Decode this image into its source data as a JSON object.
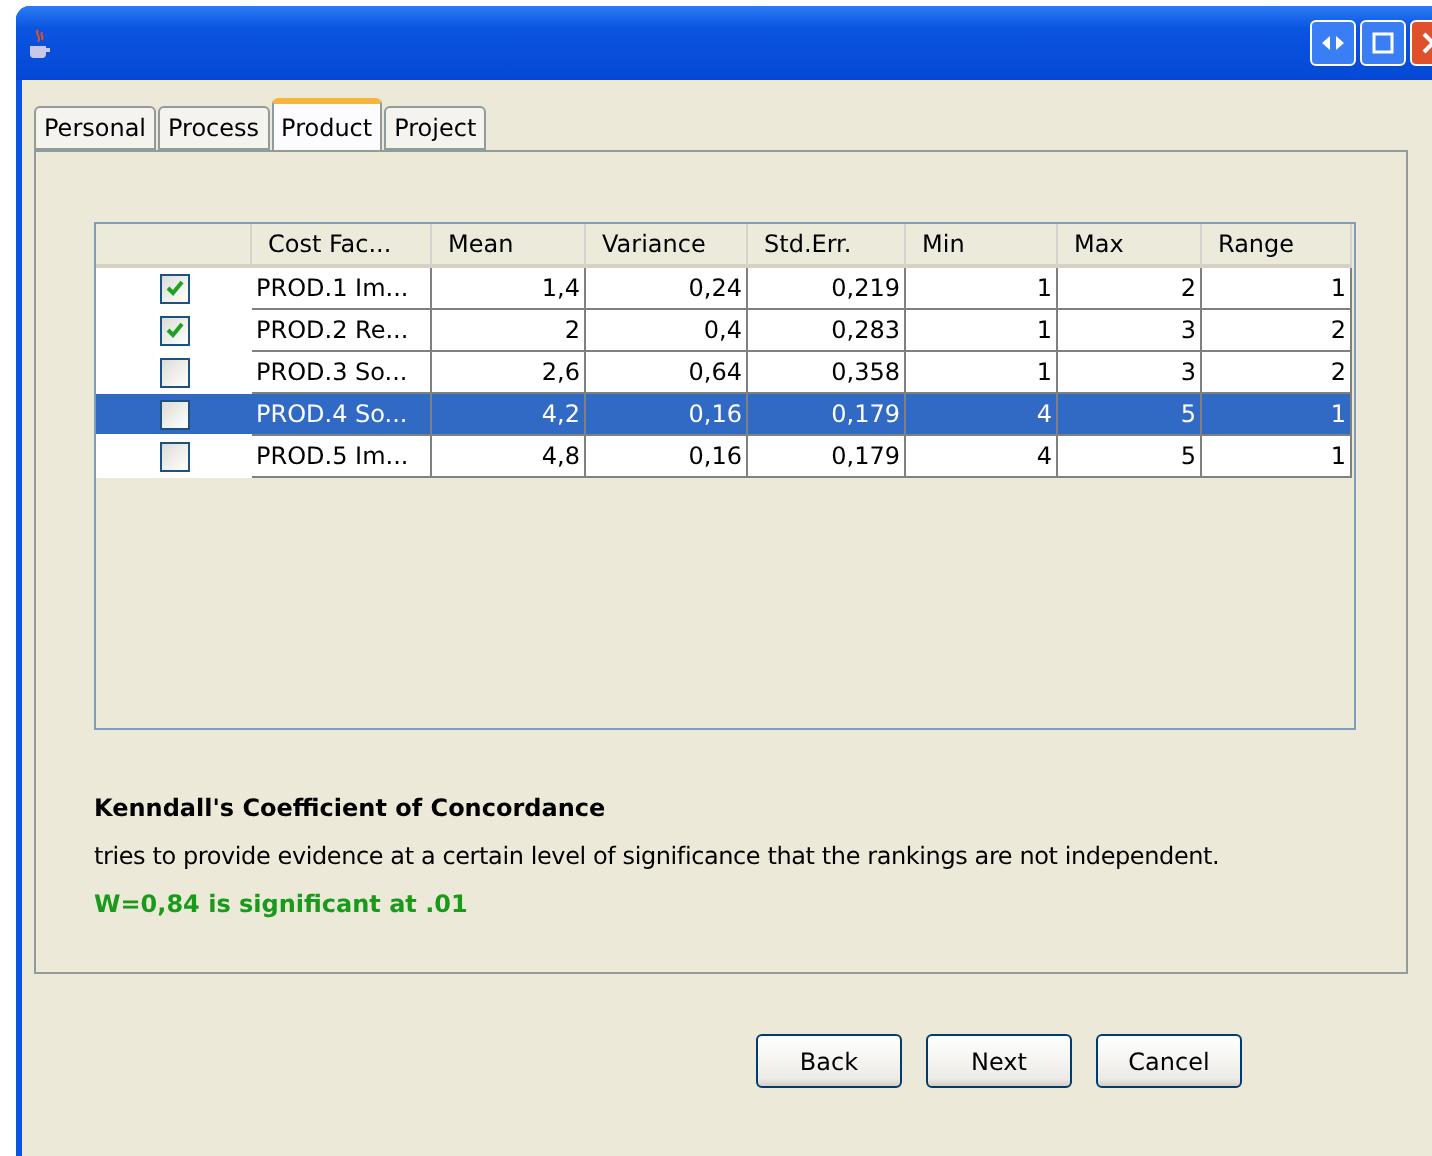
{
  "tabs": [
    {
      "label": "Personal",
      "selected": false
    },
    {
      "label": "Process",
      "selected": false
    },
    {
      "label": "Product",
      "selected": true
    },
    {
      "label": "Project",
      "selected": false
    }
  ],
  "table": {
    "columns": [
      "Cost Fac...",
      "Mean",
      "Variance",
      "Std.Err.",
      "Min",
      "Max",
      "Range"
    ],
    "rows": [
      {
        "checked": true,
        "selected": false,
        "cells": [
          "PROD.1 Im...",
          "1,4",
          "0,24",
          "0,219",
          "1",
          "2",
          "1"
        ]
      },
      {
        "checked": true,
        "selected": false,
        "cells": [
          "PROD.2 Re...",
          "2",
          "0,4",
          "0,283",
          "1",
          "3",
          "2"
        ]
      },
      {
        "checked": false,
        "selected": false,
        "cells": [
          "PROD.3 So...",
          "2,6",
          "0,64",
          "0,358",
          "1",
          "3",
          "2"
        ]
      },
      {
        "checked": false,
        "selected": true,
        "cells": [
          "PROD.4 So...",
          "4,2",
          "0,16",
          "0,179",
          "4",
          "5",
          "1"
        ]
      },
      {
        "checked": false,
        "selected": false,
        "cells": [
          "PROD.5 Im...",
          "4,8",
          "0,16",
          "0,179",
          "4",
          "5",
          "1"
        ]
      }
    ]
  },
  "result": {
    "heading": "Kenndall's Coefficient of Concordance",
    "description": "tries to provide evidence at a certain level of significance that the rankings are not independent.",
    "verdict": "W=0,84 is significant at .01"
  },
  "buttons": [
    "Back",
    "Next",
    "Cancel"
  ]
}
